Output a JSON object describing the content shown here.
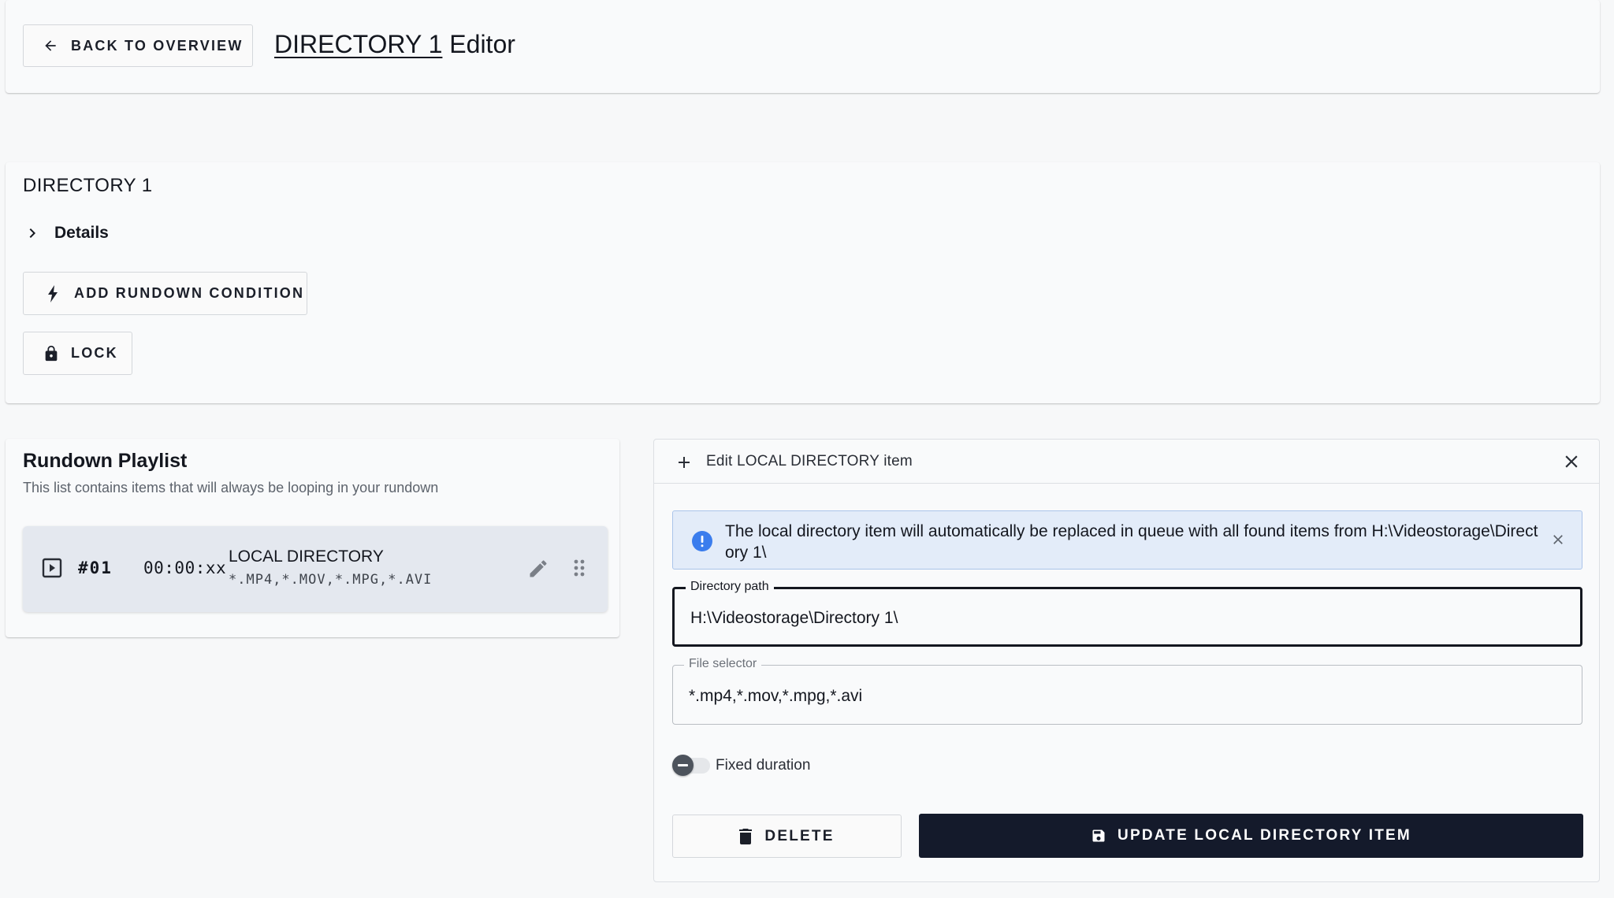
{
  "header": {
    "back_label": "BACK TO OVERVIEW",
    "title_dir": "DIRECTORY 1",
    "title_suffix": " Editor"
  },
  "directory": {
    "title": "DIRECTORY 1",
    "details_label": "Details",
    "add_condition_label": "ADD RUNDOWN CONDITION",
    "lock_label": "LOCK"
  },
  "playlist": {
    "title": "Rundown Playlist",
    "subtitle": "This list contains items that will always be looping in your rundown",
    "items": [
      {
        "number": "#01",
        "duration": "00:00:xx",
        "name": "LOCAL DIRECTORY",
        "filter": "*.MP4,*.MOV,*.MPG,*.AVI"
      }
    ]
  },
  "edit_panel": {
    "title": "Edit LOCAL DIRECTORY item",
    "alert_text": "The local directory item will automatically be replaced in queue with all found items from H:\\Videostorage\\Directory 1\\",
    "directory_path_label": "Directory path",
    "directory_path_value": "H:\\Videostorage\\Directory 1\\",
    "file_selector_label": "File selector",
    "file_selector_value": "*.mp4,*.mov,*.mpg,*.avi",
    "fixed_duration_label": "Fixed duration",
    "fixed_duration_on": false,
    "delete_label": "DELETE",
    "update_label": "UPDATE LOCAL DIRECTORY ITEM"
  },
  "colors": {
    "primary_dark": "#141a2b",
    "alert_bg": "#e3ecf9",
    "alert_icon": "#3b7ded",
    "playlist_item_bg": "#e4e8ef"
  },
  "icons": {
    "back": "arrow-left-icon",
    "details": "chevron-right-icon",
    "add_condition": "lightning-icon",
    "lock": "lock-icon",
    "play": "play-box-icon",
    "edit": "pencil-icon",
    "drag": "drag-handle-icon",
    "add": "plus-icon",
    "close": "close-icon",
    "info": "info-icon",
    "delete": "trash-icon",
    "save": "floppy-disk-icon"
  }
}
